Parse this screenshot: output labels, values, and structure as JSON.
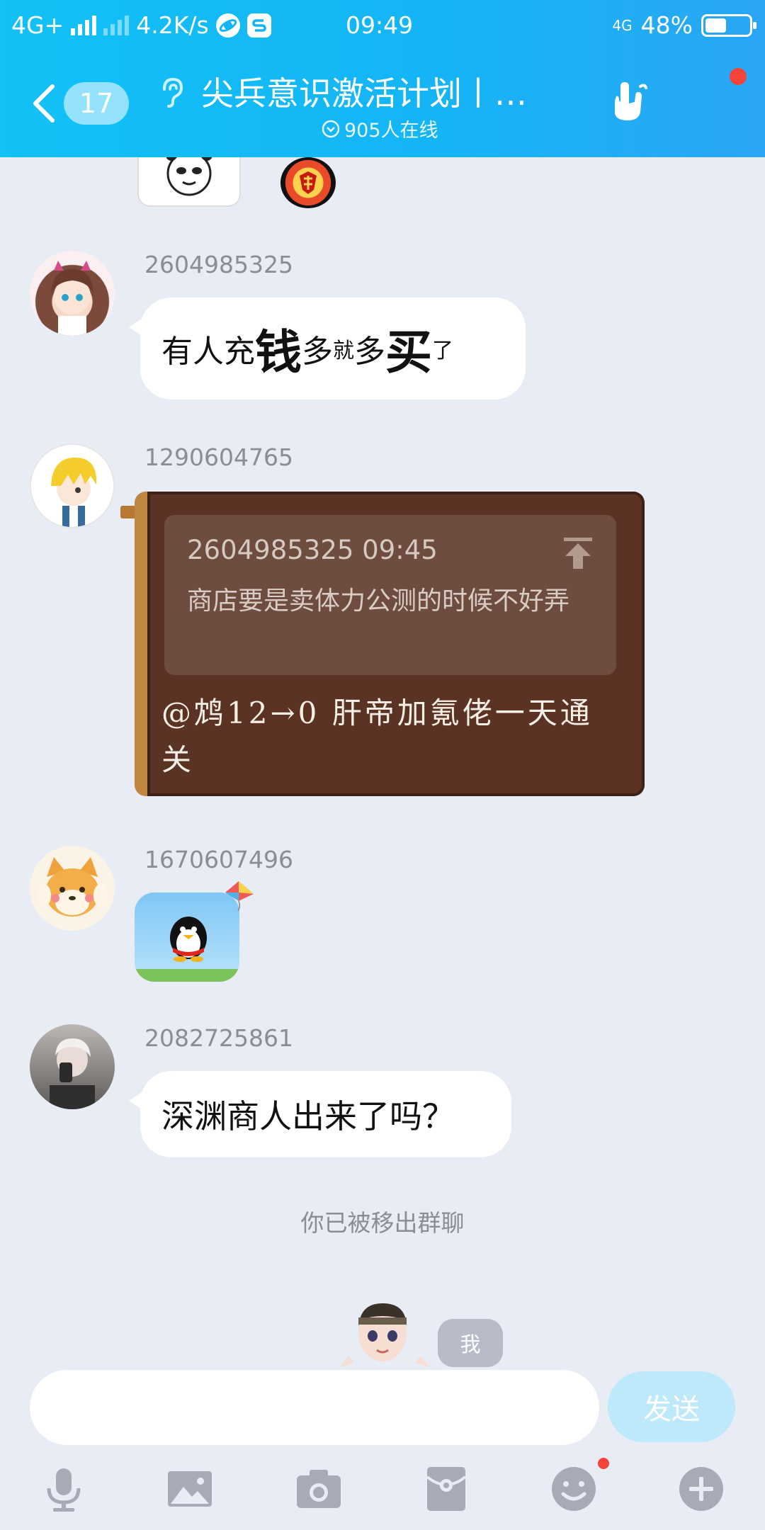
{
  "status": {
    "network": "4G+",
    "speed": "4.2K/s",
    "time": "09:49",
    "net2": "4G",
    "battery": "48%",
    "battery_level": 0.48
  },
  "header": {
    "unread_count": "17",
    "title": "尖兵意识激活计划丨…",
    "online": "905人在线"
  },
  "messages": [
    {
      "sender": "2604985325",
      "segments": [
        {
          "text": "有人充",
          "size": "md"
        },
        {
          "text": "钱",
          "size": "lg"
        },
        {
          "text": "多",
          "size": "md"
        },
        {
          "text": "就",
          "size": "xs"
        },
        {
          "text": "多",
          "size": "md"
        },
        {
          "text": "买",
          "size": "lg"
        },
        {
          "text": "了",
          "size": "xs"
        }
      ]
    },
    {
      "sender": "1290604765",
      "quote_meta": "2604985325 09:45",
      "quote_text": "商店要是卖体力公测的时候不好弄",
      "reply_text": "@鸩12→0 肝帝加氪佬一天通关"
    },
    {
      "sender": "1670607496"
    },
    {
      "sender": "2082725861",
      "text": "深渊商人出来了吗？"
    }
  ],
  "system_notice": "你已被移出群聊",
  "me_label": "我",
  "input": {
    "value": "",
    "placeholder": ""
  },
  "send_label": "发送",
  "colors": {
    "header": "#14b5f5",
    "background": "#e8ecf4",
    "bubble": "#ffffff",
    "brown_bubble": "#5a3324",
    "send_disabled": "#bde9fb",
    "dot": "#f5443c"
  },
  "toolbar_icons": [
    "microphone-icon",
    "image-icon",
    "camera-icon",
    "red-packet-icon",
    "emoji-icon",
    "plus-icon"
  ]
}
